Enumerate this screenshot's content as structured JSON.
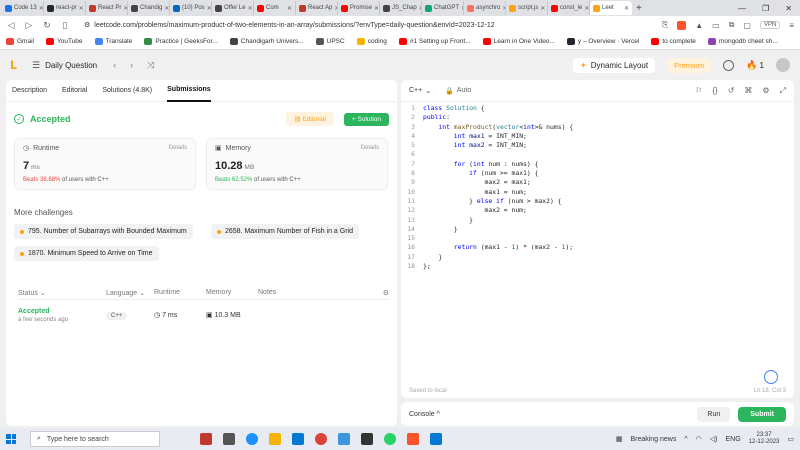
{
  "browser": {
    "tabs": [
      {
        "label": "Code 13",
        "color": "#1a73e8"
      },
      {
        "label": "react-pr",
        "color": "#24292f"
      },
      {
        "label": "React Pr",
        "color": "#c0392b"
      },
      {
        "label": "Chandig",
        "color": "#444444"
      },
      {
        "label": "(10) Pos",
        "color": "#0a66c2"
      },
      {
        "label": "Offer Le",
        "color": "#444444"
      },
      {
        "label": "Com",
        "color": "#ff0000"
      },
      {
        "label": "React Ap",
        "color": "#c0392b"
      },
      {
        "label": "Promise",
        "color": "#ff0000"
      },
      {
        "label": "JS_Chap",
        "color": "#444444"
      },
      {
        "label": "ChatGPT",
        "color": "#10a37f"
      },
      {
        "label": "asynchro",
        "color": "#ff6f61"
      },
      {
        "label": "script.js",
        "color": "#ffa116"
      },
      {
        "label": "const_le",
        "color": "#ff0000"
      },
      {
        "label": "Leet",
        "color": "#ffa116"
      }
    ],
    "url": "leetcode.com/problems/maximum-product-of-two-elements-in-an-array/submissions/?envType=daily-question&envId=2023-12-12",
    "vpn_label": "VPN",
    "bookmarks": [
      {
        "label": "Gmail",
        "color": "#ea4335"
      },
      {
        "label": "YouTube",
        "color": "#ff0000"
      },
      {
        "label": "Translate",
        "color": "#4285f4"
      },
      {
        "label": "Practice | GeeksFor...",
        "color": "#2f8d46"
      },
      {
        "label": "Chandigarh Univers...",
        "color": "#444444"
      },
      {
        "label": "UPSC",
        "color": "#555555"
      },
      {
        "label": "coding",
        "color": "#f4b400"
      },
      {
        "label": "#1 Setting up Front...",
        "color": "#ff0000"
      },
      {
        "label": "Learn in One Video...",
        "color": "#ff0000"
      },
      {
        "label": "y – Overview · Vercel",
        "color": "#24292f"
      },
      {
        "label": "to complete",
        "color": "#ff0000"
      },
      {
        "label": "mongodb cheet sh...",
        "color": "#8e44ad"
      }
    ]
  },
  "header": {
    "title": "Daily Question",
    "dynamic_layout": "Dynamic Layout",
    "premium": "Premium",
    "streak": "1"
  },
  "left_tabs": [
    "Description",
    "Editorial",
    "Solutions (4.8K)",
    "Submissions"
  ],
  "result": {
    "status": "Accepted",
    "editorial_btn": "Editorial",
    "solution_btn": "Solution",
    "runtime": {
      "label": "Runtime",
      "details": "Details",
      "value": "7",
      "unit": "ms",
      "beats": "Beats 38.88%",
      "beats_suffix": "of users with C++"
    },
    "memory": {
      "label": "Memory",
      "details": "Details",
      "value": "10.28",
      "unit": "MB",
      "beats": "Beats 62.52%",
      "beats_suffix": "of users with C++"
    }
  },
  "more_challenges": {
    "title": "More challenges",
    "items": [
      "795. Number of Subarrays with Bounded Maximum",
      "2658. Maximum Number of Fish in a Grid",
      "1870. Minimum Speed to Arrive on Time"
    ]
  },
  "submissions": {
    "headers": [
      "Status",
      "Language",
      "Runtime",
      "Memory",
      "Notes"
    ],
    "row": {
      "status": "Accepted",
      "time": "a few seconds ago",
      "language": "C++",
      "runtime": "7 ms",
      "memory": "10.3 MB"
    }
  },
  "editor": {
    "language": "C++",
    "auto": "Auto",
    "saved": "Saved to local",
    "cursor": "Ln 18, Col 3"
  },
  "console": {
    "label": "Console",
    "run": "Run",
    "submit": "Submit"
  },
  "taskbar": {
    "search_placeholder": "Type here to search",
    "news": "Breaking news",
    "lang": "ENG",
    "time": "23:37",
    "date": "12-12-2023"
  }
}
